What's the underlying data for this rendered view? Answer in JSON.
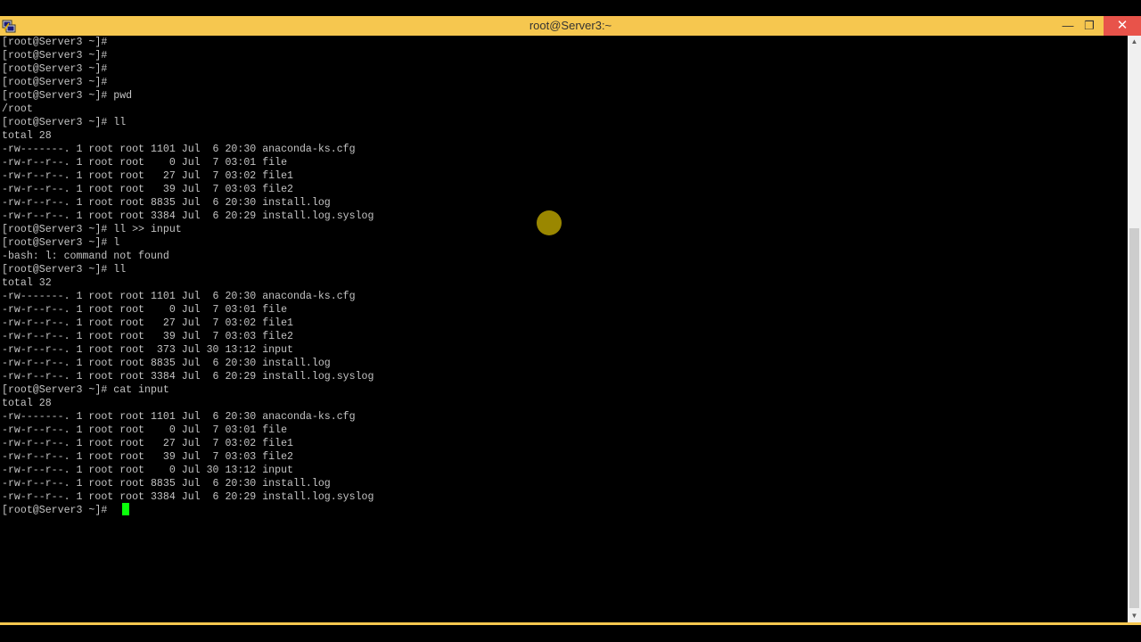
{
  "window": {
    "title": "root@Server3:~",
    "minimize_glyph": "—",
    "maximize_glyph": "❐",
    "close_glyph": "✕",
    "accent_color": "#f6c74f",
    "close_color": "#e8534a"
  },
  "terminal": {
    "text_color": "#c3c3c3",
    "background": "#000000",
    "cursor_color": "#0aff0a",
    "lines": [
      "[root@Server3 ~]#",
      "[root@Server3 ~]#",
      "[root@Server3 ~]#",
      "[root@Server3 ~]#",
      "[root@Server3 ~]# pwd",
      "/root",
      "[root@Server3 ~]# ll",
      "total 28",
      "-rw-------. 1 root root 1101 Jul  6 20:30 anaconda-ks.cfg",
      "-rw-r--r--. 1 root root    0 Jul  7 03:01 file",
      "-rw-r--r--. 1 root root   27 Jul  7 03:02 file1",
      "-rw-r--r--. 1 root root   39 Jul  7 03:03 file2",
      "-rw-r--r--. 1 root root 8835 Jul  6 20:30 install.log",
      "-rw-r--r--. 1 root root 3384 Jul  6 20:29 install.log.syslog",
      "[root@Server3 ~]# ll >> input",
      "[root@Server3 ~]# l",
      "-bash: l: command not found",
      "[root@Server3 ~]# ll",
      "total 32",
      "-rw-------. 1 root root 1101 Jul  6 20:30 anaconda-ks.cfg",
      "-rw-r--r--. 1 root root    0 Jul  7 03:01 file",
      "-rw-r--r--. 1 root root   27 Jul  7 03:02 file1",
      "-rw-r--r--. 1 root root   39 Jul  7 03:03 file2",
      "-rw-r--r--. 1 root root  373 Jul 30 13:12 input",
      "-rw-r--r--. 1 root root 8835 Jul  6 20:30 install.log",
      "-rw-r--r--. 1 root root 3384 Jul  6 20:29 install.log.syslog",
      "[root@Server3 ~]# cat input",
      "total 28",
      "-rw-------. 1 root root 1101 Jul  6 20:30 anaconda-ks.cfg",
      "-rw-r--r--. 1 root root    0 Jul  7 03:01 file",
      "-rw-r--r--. 1 root root   27 Jul  7 03:02 file1",
      "-rw-r--r--. 1 root root   39 Jul  7 03:03 file2",
      "-rw-r--r--. 1 root root    0 Jul 30 13:12 input",
      "-rw-r--r--. 1 root root 8835 Jul  6 20:30 install.log",
      "-rw-r--r--. 1 root root 3384 Jul  6 20:29 install.log.syslog",
      "[root@Server3 ~]#"
    ]
  },
  "scrollbar": {
    "up_glyph": "▲",
    "down_glyph": "▼"
  }
}
